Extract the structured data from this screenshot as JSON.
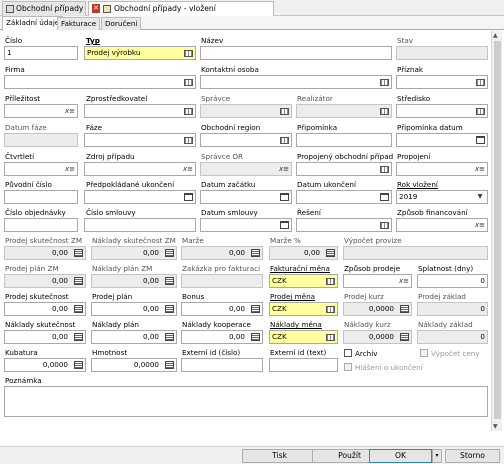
{
  "window_tabs": [
    {
      "label": "Obchodní případy",
      "close": ""
    },
    {
      "label": "Obchodní případy - vložení",
      "close": "✕"
    }
  ],
  "subtabs": [
    "Základní údaje",
    "Fakturace",
    "Doručení"
  ],
  "labels": {
    "cislo": "Číslo",
    "typ": "Typ",
    "nazev": "Název",
    "stav": "Stav",
    "firma": "Firma",
    "kontaktni_osoba": "Kontaktní osoba",
    "priznak": "Příznak",
    "prilezitost": "Příležitost",
    "zprostredkovatel": "Zprostředkovatel",
    "spravce": "Správce",
    "realizator": "Realizátor",
    "stredisko": "Středisko",
    "datum_faze": "Datum fáze",
    "faze": "Fáze",
    "obchodni_region": "Obchodní region",
    "pripominka": "Připomínka",
    "pripominka_datum": "Připomínka datum",
    "ctvrtleti": "Čtvrtletí",
    "zdroj_pripadu": "Zdroj případu",
    "spravce_or": "Správce OR",
    "propojeny_obchodni_pripad": "Propojený obchodní případ",
    "propojeni": "Propojení",
    "puvodni_cislo": "Původní číslo",
    "predpokladane_ukonceni": "Předpokládané ukončení",
    "datum_zacatku": "Datum začátku",
    "datum_ukonceni": "Datum ukončení",
    "rok_vlozeni": "Rok vložení",
    "cislo_objednavky": "Číslo objednávky",
    "cislo_smlouvy": "Číslo smlouvy",
    "datum_smlouvy": "Datum smlouvy",
    "reseni": "Řešení",
    "zpusob_financovani": "Způsob financování",
    "prodej_skutecnost_zm": "Prodej skutečnost ZM",
    "naklady_skutecnost_zm": "Náklady skutečnost ZM",
    "marze": "Marže",
    "marze_pct": "Marže %",
    "vypocet_provize": "Výpočet provize",
    "prodej_plan_zm": "Prodej plán ZM",
    "naklady_plan_zm": "Náklady plán ZM",
    "zakazka_pro_fakturaci": "Zakázka pro fakturaci",
    "fakturacni_mena": "Fakturační měna",
    "zpusob_prodeje": "Způsob prodeje",
    "splatnost": "Splatnost (dny)",
    "prodej_skutecnost": "Prodej skutečnost",
    "prodej_plan": "Prodej plán",
    "bonus": "Bonus",
    "prodej_mena": "Prodej měna",
    "prodej_kurz": "Prodej kurz",
    "prodej_zaklad": "Prodej základ",
    "naklady_skutecnost": "Náklady skutečnost",
    "naklady_plan": "Náklady plán",
    "naklady_kooperace": "Náklady kooperace",
    "naklady_mena": "Náklady měna",
    "naklady_kurz": "Náklady kurz",
    "naklady_zaklad": "Náklady základ",
    "kubatura": "Kubatura",
    "hmotnost": "Hmotnost",
    "externi_id_cislo": "Externí id (číslo)",
    "externi_id_text": "Externí id (text)",
    "archiv": "Archív",
    "vypocet_ceny": "Výpočet ceny",
    "hlaseni_o_ukonceni": "Hlášení o ukončení",
    "poznamka": "Poznámka"
  },
  "values": {
    "cislo": "1",
    "typ": "Prodej výrobku",
    "rok_vlozeni": "2019",
    "prodej_skutecnost_zm": "0,00",
    "naklady_skutecnost_zm": "0,00",
    "marze": "0,00",
    "marze_pct": "0,00",
    "prodej_plan_zm": "0,00",
    "naklady_plan_zm": "0,00",
    "fakturacni_mena": "CZK",
    "splatnost": "0",
    "prodej_skutecnost": "0,00",
    "prodej_plan": "0,00",
    "bonus": "0,00",
    "prodej_mena": "CZK",
    "prodej_kurz": "0,0000",
    "prodej_zaklad": "0",
    "naklady_skutecnost": "0,00",
    "naklady_plan": "0,00",
    "naklady_kooperace": "0,00",
    "naklady_mena": "CZK",
    "naklady_kurz": "0,0000",
    "naklady_zaklad": "0",
    "kubatura": "0,0000",
    "hmotnost": "0,0000"
  },
  "buttons": {
    "tisk": "Tisk",
    "pouzit": "Použít",
    "ok": "OK",
    "ok_dropdown": "▾",
    "storno": "Storno"
  },
  "colors": {
    "required_field": "#ffff9e",
    "readonly_field": "#ececec",
    "close_tab_icon": "#c0392b"
  }
}
